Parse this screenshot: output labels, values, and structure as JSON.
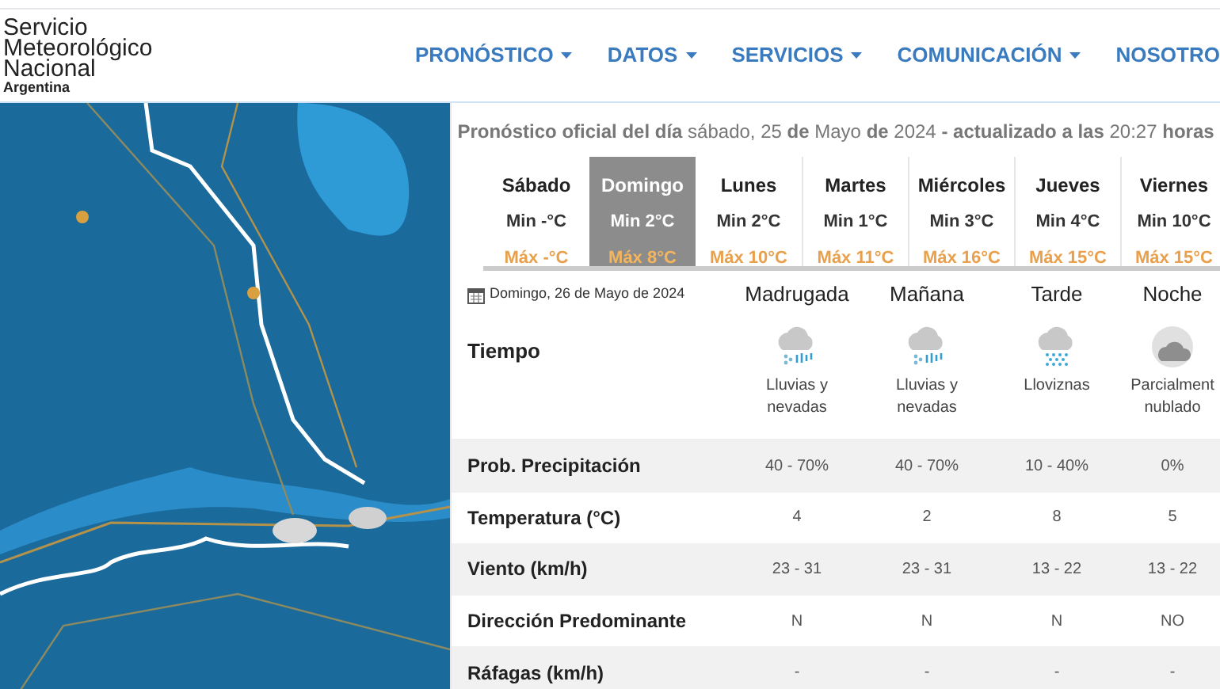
{
  "logo": {
    "lines": [
      "Servicio",
      "Meteorológico",
      "Nacional"
    ],
    "country": "Argentina"
  },
  "nav": [
    {
      "label": "PRONÓSTICO",
      "dropdown": true
    },
    {
      "label": "DATOS",
      "dropdown": true
    },
    {
      "label": "SERVICIOS",
      "dropdown": true
    },
    {
      "label": "COMUNICACIÓN",
      "dropdown": true
    },
    {
      "label": "NOSOTRO",
      "dropdown": false
    }
  ],
  "forecast_header": "**Pronóstico oficial del día** sábado, 25 **de** Mayo **de** 2024 **- actualizado a las** 20:27 **horas**",
  "days": [
    {
      "name": "Sábado",
      "min": "Min -°C",
      "max": "Máx -°C",
      "selected": false
    },
    {
      "name": "Domingo",
      "min": "Min 2°C",
      "max": "Máx 8°C",
      "selected": true
    },
    {
      "name": "Lunes",
      "min": "Min 2°C",
      "max": "Máx 10°C",
      "selected": false
    },
    {
      "name": "Martes",
      "min": "Min 1°C",
      "max": "Máx 11°C",
      "selected": false
    },
    {
      "name": "Miércoles",
      "min": "Min 3°C",
      "max": "Máx 16°C",
      "selected": false
    },
    {
      "name": "Jueves",
      "min": "Min 4°C",
      "max": "Máx 15°C",
      "selected": false
    },
    {
      "name": "Viernes",
      "min": "Min 10°C",
      "max": "Máx 15°C",
      "selected": false
    }
  ],
  "detail": {
    "date": "Domingo, 26 de Mayo de 2024",
    "periods": [
      "Madrugada",
      "Mañana",
      "Tarde",
      "Noche"
    ],
    "weather_label": "Tiempo",
    "weather": [
      {
        "kind": "rain_snow",
        "text": "Lluvias y nevadas"
      },
      {
        "kind": "rain_snow",
        "text": "Lluvias y nevadas"
      },
      {
        "kind": "drizzle",
        "text": "Lloviznas"
      },
      {
        "kind": "partly_cloudy_night",
        "text": "Parcialment nublado"
      }
    ],
    "rows": [
      {
        "label": "Prob. Precipitación",
        "values": [
          "40 - 70%",
          "40 - 70%",
          "10 - 40%",
          "0%"
        ]
      },
      {
        "label": "Temperatura (°C)",
        "values": [
          "4",
          "2",
          "8",
          "5"
        ]
      },
      {
        "label": "Viento (km/h)",
        "values": [
          "23 - 31",
          "23 - 31",
          "13 - 22",
          "13 - 22"
        ]
      },
      {
        "label": "Dirección Predominante",
        "values": [
          "N",
          "N",
          "N",
          "NO"
        ]
      },
      {
        "label": "Ráfagas (km/h)",
        "values": [
          "-",
          "-",
          "-",
          "-"
        ]
      }
    ]
  }
}
